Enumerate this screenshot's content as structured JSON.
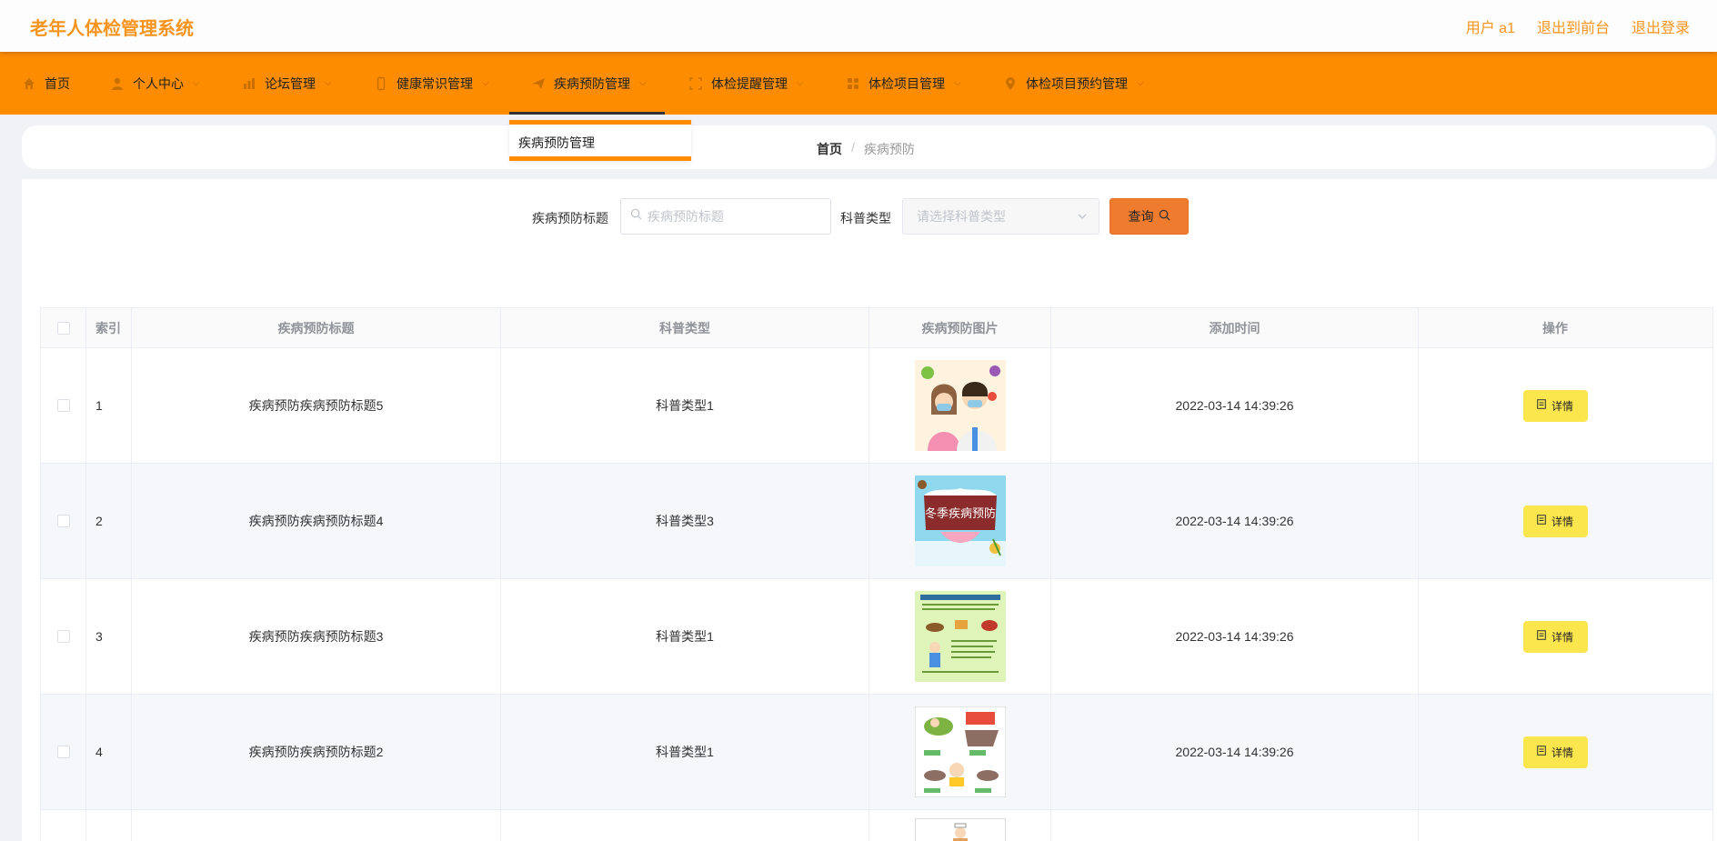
{
  "header": {
    "app_title": "老年人体检管理系统",
    "links": [
      "用户 a1",
      "退出到前台",
      "退出登录"
    ]
  },
  "nav": {
    "items": [
      {
        "label": "首页",
        "icon": "home-icon",
        "has_chevron": false
      },
      {
        "label": "个人中心",
        "icon": "user-icon",
        "has_chevron": true
      },
      {
        "label": "论坛管理",
        "icon": "chart-icon",
        "has_chevron": true
      },
      {
        "label": "健康常识管理",
        "icon": "phone-icon",
        "has_chevron": true
      },
      {
        "label": "疾病预防管理",
        "icon": "send-icon",
        "has_chevron": true
      },
      {
        "label": "体检提醒管理",
        "icon": "frame-icon",
        "has_chevron": true
      },
      {
        "label": "体检项目管理",
        "icon": "grid-icon",
        "has_chevron": true
      },
      {
        "label": "体检项目预约管理",
        "icon": "location-icon",
        "has_chevron": true
      }
    ],
    "active_index": 4,
    "dropdown_item": "疾病预防管理"
  },
  "breadcrumb": {
    "home": "首页",
    "separator": "/",
    "current": "疾病预防"
  },
  "search": {
    "title_label": "疾病预防标题",
    "title_placeholder": "疾病预防标题",
    "type_label": "科普类型",
    "type_placeholder": "请选择科普类型",
    "query_label": "查询"
  },
  "table": {
    "columns": [
      "索引",
      "疾病预防标题",
      "科普类型",
      "疾病预防图片",
      "添加时间",
      "操作"
    ],
    "rows": [
      {
        "index": "1",
        "title": "疾病预防疾病预防标题5",
        "type": "科普类型1",
        "image": "cartoon-children-masks-image",
        "time": "2022-03-14 14:39:26",
        "action": "详情"
      },
      {
        "index": "2",
        "title": "疾病预防疾病预防标题4",
        "type": "科普类型3",
        "image": "winter-disease-prevention-image",
        "time": "2022-03-14 14:39:26",
        "action": "详情"
      },
      {
        "index": "3",
        "title": "疾病预防疾病预防标题3",
        "type": "科普类型1",
        "image": "health-poster-image",
        "time": "2022-03-14 14:39:26",
        "action": "详情"
      },
      {
        "index": "4",
        "title": "疾病预防疾病预防标题2",
        "type": "科普类型1",
        "image": "prevention-tips-image",
        "time": "2022-03-14 14:39:26",
        "action": "详情"
      }
    ]
  },
  "colors": {
    "accent": "#fd8c00",
    "title": "#f7941d",
    "query_button": "#ee7b2e",
    "detail_button": "#fce64d"
  }
}
